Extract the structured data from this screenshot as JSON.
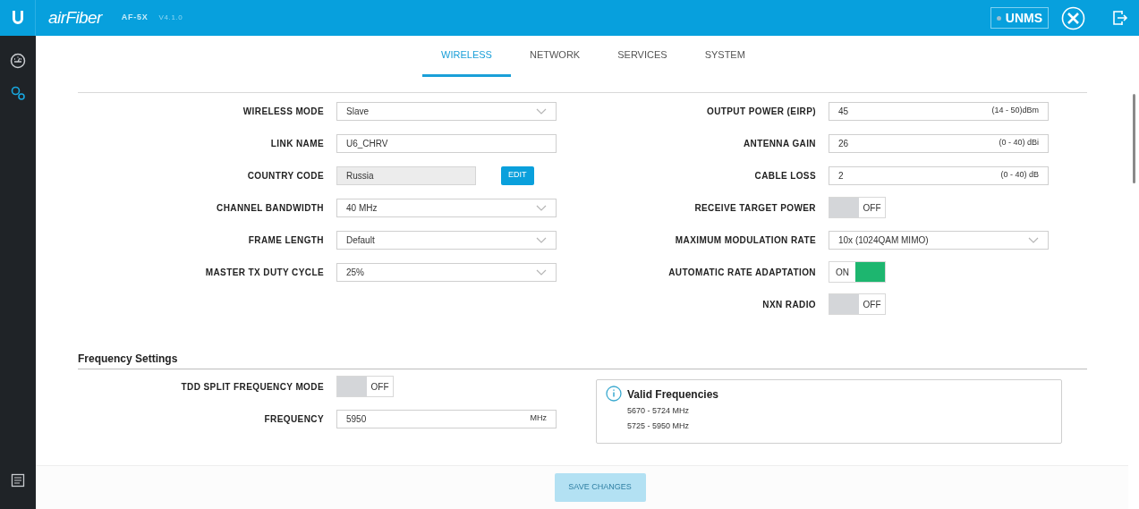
{
  "header": {
    "brand": "airFiber",
    "model": "AF-5X",
    "version": "V4.1.0",
    "unms": {
      "label": "UNMS",
      "connected": false
    }
  },
  "sidebar": {
    "items": [
      {
        "kind": "dashboard",
        "selected": false
      },
      {
        "kind": "settings",
        "selected": true
      }
    ]
  },
  "tabs": [
    {
      "label": "WIRELESS",
      "selected": true
    },
    {
      "label": "NETWORK",
      "selected": false
    },
    {
      "label": "SERVICES",
      "selected": false
    },
    {
      "label": "SYSTEM",
      "selected": false
    }
  ],
  "basic_wireless": {
    "left": [
      {
        "kind": "select",
        "label": "WIRELESS MODE",
        "value": "Slave"
      },
      {
        "kind": "text",
        "label": "LINK NAME",
        "value": "U6_CHRV"
      },
      {
        "kind": "locked",
        "label": "COUNTRY CODE",
        "value": "Russia",
        "button": "EDIT"
      },
      {
        "kind": "select",
        "label": "CHANNEL BANDWIDTH",
        "value": "40 MHz"
      },
      {
        "kind": "select",
        "label": "FRAME LENGTH",
        "value": "Default"
      },
      {
        "kind": "select",
        "label": "MASTER TX DUTY CYCLE",
        "value": "25%"
      }
    ],
    "right": [
      {
        "kind": "text",
        "label": "OUTPUT POWER (EIRP)",
        "value": "45",
        "unit": "(14 - 50)dBm"
      },
      {
        "kind": "text",
        "label": "ANTENNA GAIN",
        "value": "26",
        "unit": "(0 - 40) dBi"
      },
      {
        "kind": "text",
        "label": "CABLE LOSS",
        "value": "2",
        "unit": "(0 - 40) dB"
      },
      {
        "kind": "toggle",
        "label": "RECEIVE TARGET POWER",
        "on": false,
        "state_text": "OFF"
      },
      {
        "kind": "select",
        "label": "MAXIMUM MODULATION RATE",
        "value": "10x (1024QAM MIMO)"
      },
      {
        "kind": "toggle",
        "label": "AUTOMATIC RATE ADAPTATION",
        "on": true,
        "state_text": "ON"
      },
      {
        "kind": "toggle",
        "label": "NXN RADIO",
        "on": false,
        "state_text": "OFF"
      }
    ]
  },
  "frequency_settings": {
    "title": "Frequency Settings",
    "rows": [
      {
        "kind": "toggle",
        "label": "TDD SPLIT FREQUENCY MODE",
        "on": false,
        "state_text": "OFF"
      },
      {
        "kind": "text",
        "label": "FREQUENCY",
        "value": "5950",
        "unit": "MHz"
      }
    ],
    "info": {
      "title": "Valid Frequencies",
      "lines": [
        "5670 - 5724 MHz",
        "5725 - 5950 MHz"
      ]
    }
  },
  "save_button": {
    "label": "SAVE CHANGES",
    "disabled": true
  }
}
